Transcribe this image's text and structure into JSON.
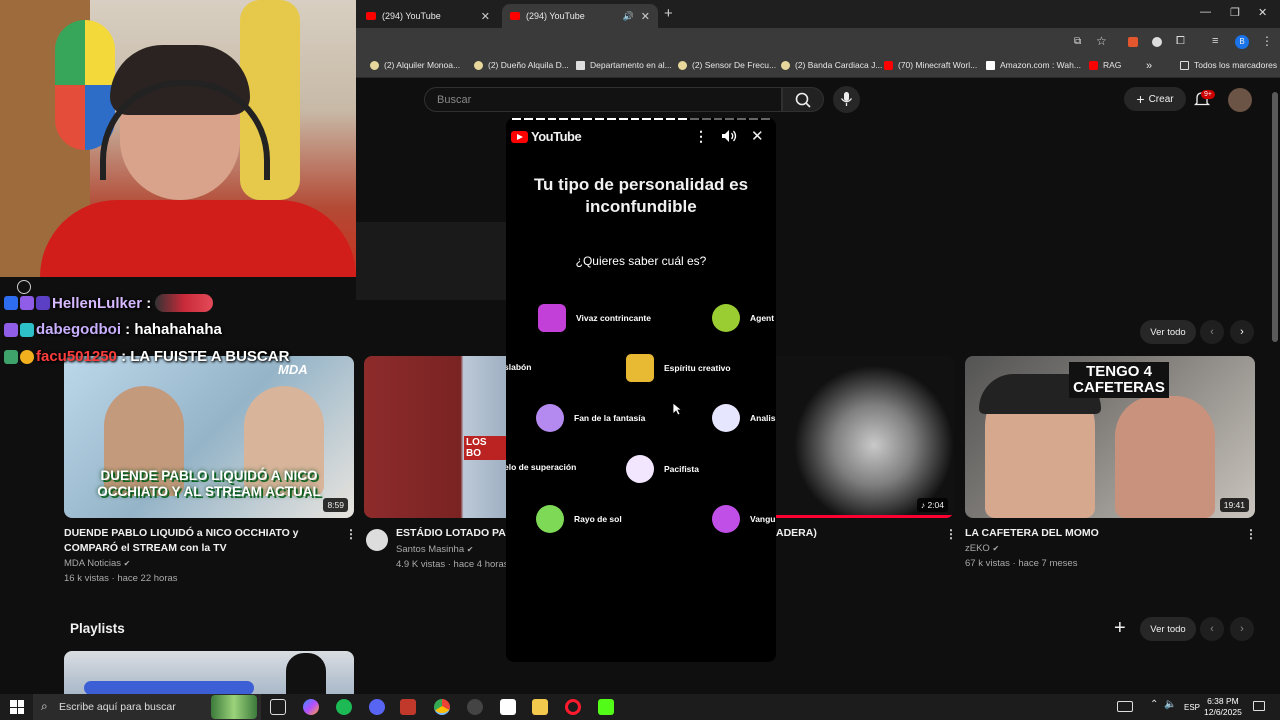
{
  "browser": {
    "tabs": [
      {
        "title": "(294) YouTube"
      },
      {
        "title": "(294) YouTube"
      }
    ],
    "bookmarks": [
      "(2) Alquiler Monoa...",
      "(2) Dueño Alquila D...",
      "Departamento en al...",
      "(2) Sensor De Frecu...",
      "(2) Banda Cardiaca J...",
      "(70) Minecraft Worl...",
      "Amazon.com : Wah...",
      "RAG",
      "Todos los marcadores"
    ],
    "overflow": "»"
  },
  "youtube": {
    "search_placeholder": "Buscar",
    "create_label": "Crear",
    "notif_badge": "9+",
    "see_all_1": "Ver todo",
    "see_all_2": "Ver todo",
    "playlists_heading": "Playlists",
    "videos": [
      {
        "thumb_text": "DUENDE PABLO LIQUIDÓ A NICO OCCHIATO Y AL STREAM ACTUAL",
        "thumb_tag": "MDA",
        "duration": "8:59",
        "title": "DUENDE PABLO LIQUIDÓ a NICO OCCHIATO y COMPARÓ el STREAM con la TV",
        "channel": "MDA Noticias",
        "meta": "16 k vistas · hace 22 horas"
      },
      {
        "thumb_text": "LOS BO",
        "title": "ESTÁDIO LOTADO PAR",
        "channel": "Santos Masinha",
        "meta": "4.9 K vistas · hace 4 horas"
      },
      {
        "duration": "♪ 2:04",
        "title": "ADERA)"
      },
      {
        "thumb_text": "TENGO 4 CAFETERAS",
        "duration": "19:41",
        "title": "LA CAFETERA DEL MOMO",
        "channel": "zEKO",
        "meta": "67 k vistas · hace 7 meses"
      }
    ]
  },
  "chat": [
    {
      "user": "HellenLulker",
      "message": ""
    },
    {
      "user": "dabegodboi",
      "message": "hahahahaha"
    },
    {
      "user": "facu501250",
      "message": "LA FUISTE A BUSCAR"
    }
  ],
  "shorts_modal": {
    "logo": "YouTube",
    "title": "Tu tipo de personalidad es inconfundible",
    "question": "¿Quieres saber cuál es?",
    "options": [
      {
        "label": "Vivaz contrincante",
        "color": "#c23fd8"
      },
      {
        "label": "Agent",
        "color": "#9acd32"
      },
      {
        "label": "slabón",
        "color": ""
      },
      {
        "label": "Espíritu creativo",
        "color": "#e8b932"
      },
      {
        "label": "Fan de la fantasía",
        "color": "#b58af0"
      },
      {
        "label": "Analis",
        "color": "#e6e6ff"
      },
      {
        "label": "elo de superación",
        "color": ""
      },
      {
        "label": "Pacifista",
        "color": "#f2e6ff"
      },
      {
        "label": "Rayo de sol",
        "color": "#7ed957"
      },
      {
        "label": "Vangu",
        "color": "#c04fe8"
      }
    ]
  },
  "taskbar": {
    "search_placeholder": "Escribe aquí para buscar",
    "lang": "ESP",
    "time": "6:38 PM",
    "date": "12/6/2025"
  }
}
